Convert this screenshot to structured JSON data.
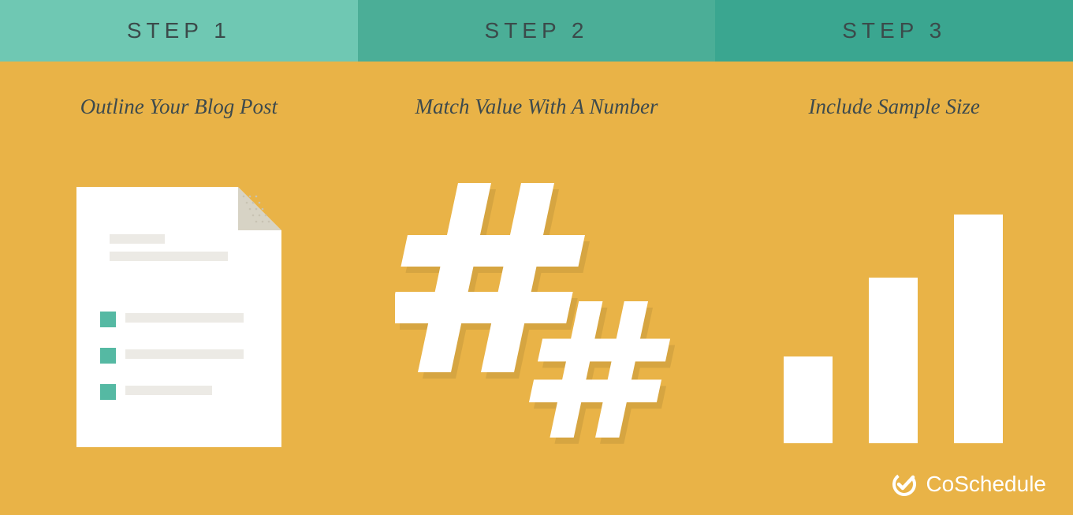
{
  "steps": [
    {
      "tab": "STEP 1",
      "title": "Outline Your Blog Post"
    },
    {
      "tab": "STEP 2",
      "title": "Match Value With A Number"
    },
    {
      "tab": "STEP 3",
      "title": "Include Sample Size"
    }
  ],
  "brand": "CoSchedule",
  "colors": {
    "bg": "#e9b347",
    "tab1": "#6fc8b3",
    "tab2": "#4bae97",
    "tab3": "#3aa690",
    "text": "#3d4a4d",
    "white": "#ffffff",
    "accent": "#55b9a3",
    "fold": "#d7d3c5",
    "line": "#eceae5"
  }
}
